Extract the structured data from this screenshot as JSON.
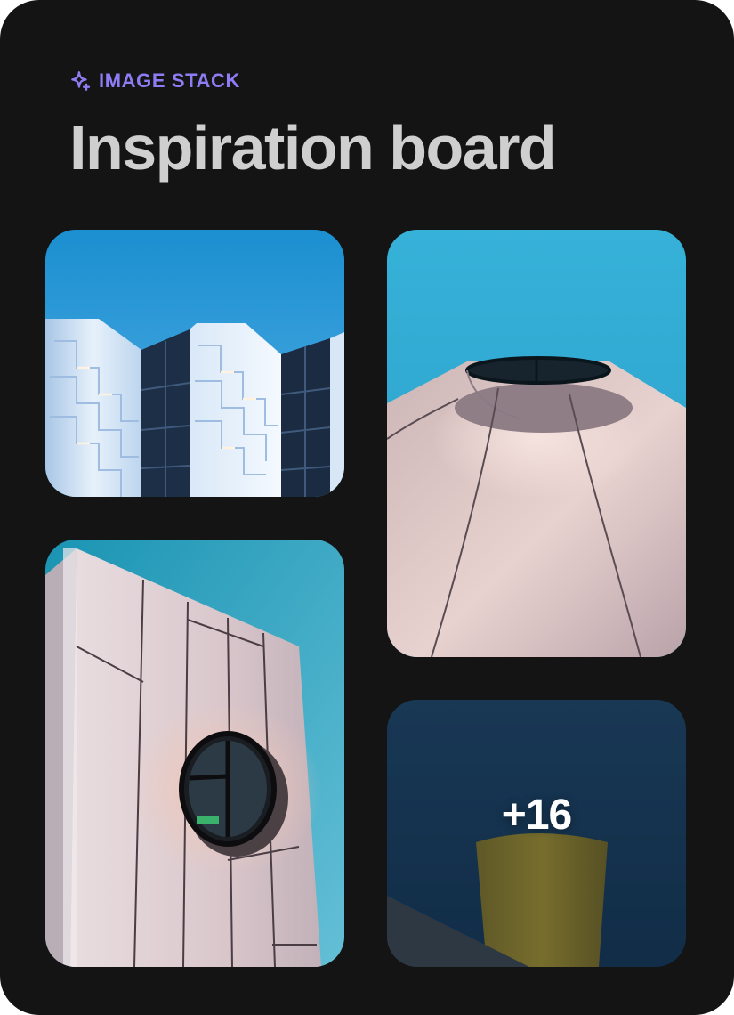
{
  "header": {
    "eyebrow_label": "IMAGE STACK",
    "eyebrow_icon": "sparkle-icon",
    "title": "Inspiration board"
  },
  "colors": {
    "card_background": "#141414",
    "eyebrow_accent": "#8e7cf4",
    "title_text": "#cfcfcf",
    "overlay_text": "#ffffff"
  },
  "gallery": {
    "tiles": [
      {
        "name": "white facade towers with dark windows against blue sky"
      },
      {
        "name": "rounded rooftop with circular skylight opening"
      },
      {
        "name": "white paneled building with round porthole window"
      },
      {
        "name": "dark blue image with yellow cylinder"
      }
    ],
    "more_count_label": "+16"
  }
}
